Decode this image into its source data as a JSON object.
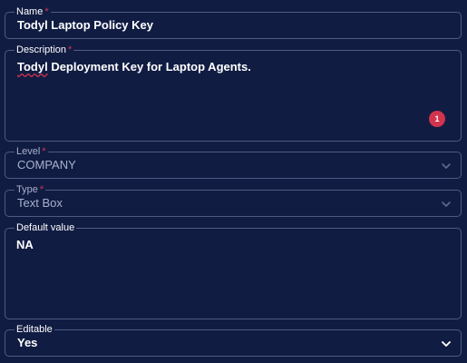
{
  "fields": {
    "name": {
      "label": "Name",
      "required_mark": "*",
      "value": "Todyl Laptop Policy Key"
    },
    "description": {
      "label": "Description",
      "required_mark": "*",
      "value_misspelled": "Todyl",
      "value_rest": " Deployment Key for Laptop Agents.",
      "spellcheck_count": "1"
    },
    "level": {
      "label": "Level",
      "required_mark": "*",
      "value": "COMPANY",
      "icon": "chevron-down-icon",
      "disabled": true
    },
    "type": {
      "label": "Type",
      "required_mark": "*",
      "value": "Text Box",
      "icon": "chevron-down-icon",
      "disabled": true
    },
    "default_value": {
      "label": "Default value",
      "value": "NA"
    },
    "editable": {
      "label": "Editable",
      "value": "Yes",
      "icon": "chevron-down-icon"
    }
  },
  "colors": {
    "background": "#111c43",
    "border": "#4f5b86",
    "required": "#d2334d",
    "text": "#ffffff",
    "muted_text": "#a8b0cc"
  }
}
